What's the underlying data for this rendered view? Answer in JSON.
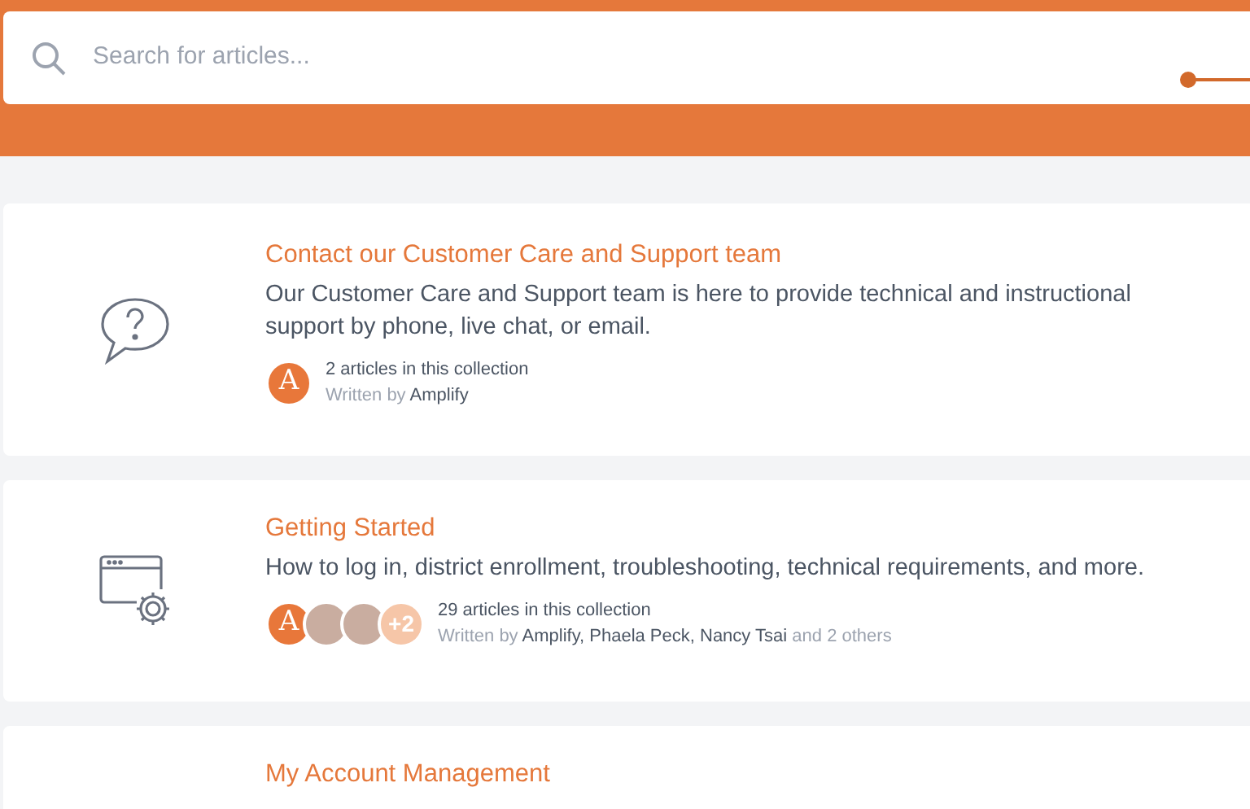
{
  "search": {
    "placeholder": "Search for articles..."
  },
  "collections": [
    {
      "kind": "question",
      "title": "Contact our Customer Care and Support team",
      "description": "Our Customer Care and Support team is here to provide technical and instructional support by phone, live chat, or email.",
      "avatars": [
        {
          "kind": "letter",
          "text": "A"
        }
      ],
      "count": "2 articles in this collection",
      "authors": "Written by **Amplify**"
    },
    {
      "kind": "settings",
      "title": "Getting Started",
      "description": "How to log in, district enrollment, troubleshooting, technical requirements, and more.",
      "avatars": [
        {
          "kind": "letter",
          "text": "A"
        },
        {
          "kind": "photo"
        },
        {
          "kind": "photo"
        },
        {
          "kind": "count",
          "text": "+2"
        }
      ],
      "count": "29 articles in this collection",
      "authors": "Written by **Amplify, Phaela Peck, Nancy Tsai** and 2 others"
    },
    {
      "kind": "plain",
      "title": "My Account Management"
    }
  ]
}
